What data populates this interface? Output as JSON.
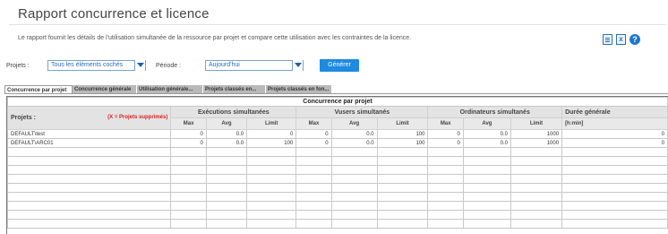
{
  "page": {
    "title": "Rapport concurrence et licence",
    "description": "Le rapport fournit les détails de l'utilisation simultanée de la ressource par projet et compare cette utilisation avec les contraintes de la licence."
  },
  "icons": [
    "export-pdf-icon",
    "export-excel-icon",
    "help-icon"
  ],
  "filters": {
    "projects_label": "Projets :",
    "projects_value": "Tous les éléments cochés",
    "period_label": "Période :",
    "period_value": "Aujourd'hui",
    "generate_label": "Générer"
  },
  "tabs": [
    "Concurrence par projet",
    "Concurrence générale",
    "Utilisation générale...",
    "Projets classés en...",
    "Projets classés en fon..."
  ],
  "table": {
    "caption": "Concurrence par projet",
    "col_projects": "Projets :",
    "deleted_note": "(X = Projets supprimés)",
    "groups": [
      "Exécutions simultanées",
      "Vusers simultanés",
      "Ordinateurs simultanés",
      "Durée générale"
    ],
    "sub": [
      "Max",
      "Avg",
      "Limit",
      "Max",
      "Avg",
      "Limit",
      "Max",
      "Avg",
      "Limit"
    ],
    "duration_sub": "[h:min]",
    "rows": [
      {
        "project": "DEFAULT\\test",
        "values": [
          "0",
          "0.0",
          "0",
          "0",
          "0.0",
          "100",
          "0",
          "0.0",
          "1000",
          "0"
        ]
      },
      {
        "project": "DEFAULT\\ARC01",
        "values": [
          "0",
          "0.0",
          "100",
          "0",
          "0.0",
          "100",
          "0",
          "0.0",
          "1000",
          "0"
        ]
      }
    ]
  },
  "colors": {
    "accent": "#1e8ae0",
    "link": "#2a6fb8",
    "deleted_note": "#e02020",
    "header_bg": "#e3e3e3",
    "tab_bg": "#b9b9b9"
  }
}
